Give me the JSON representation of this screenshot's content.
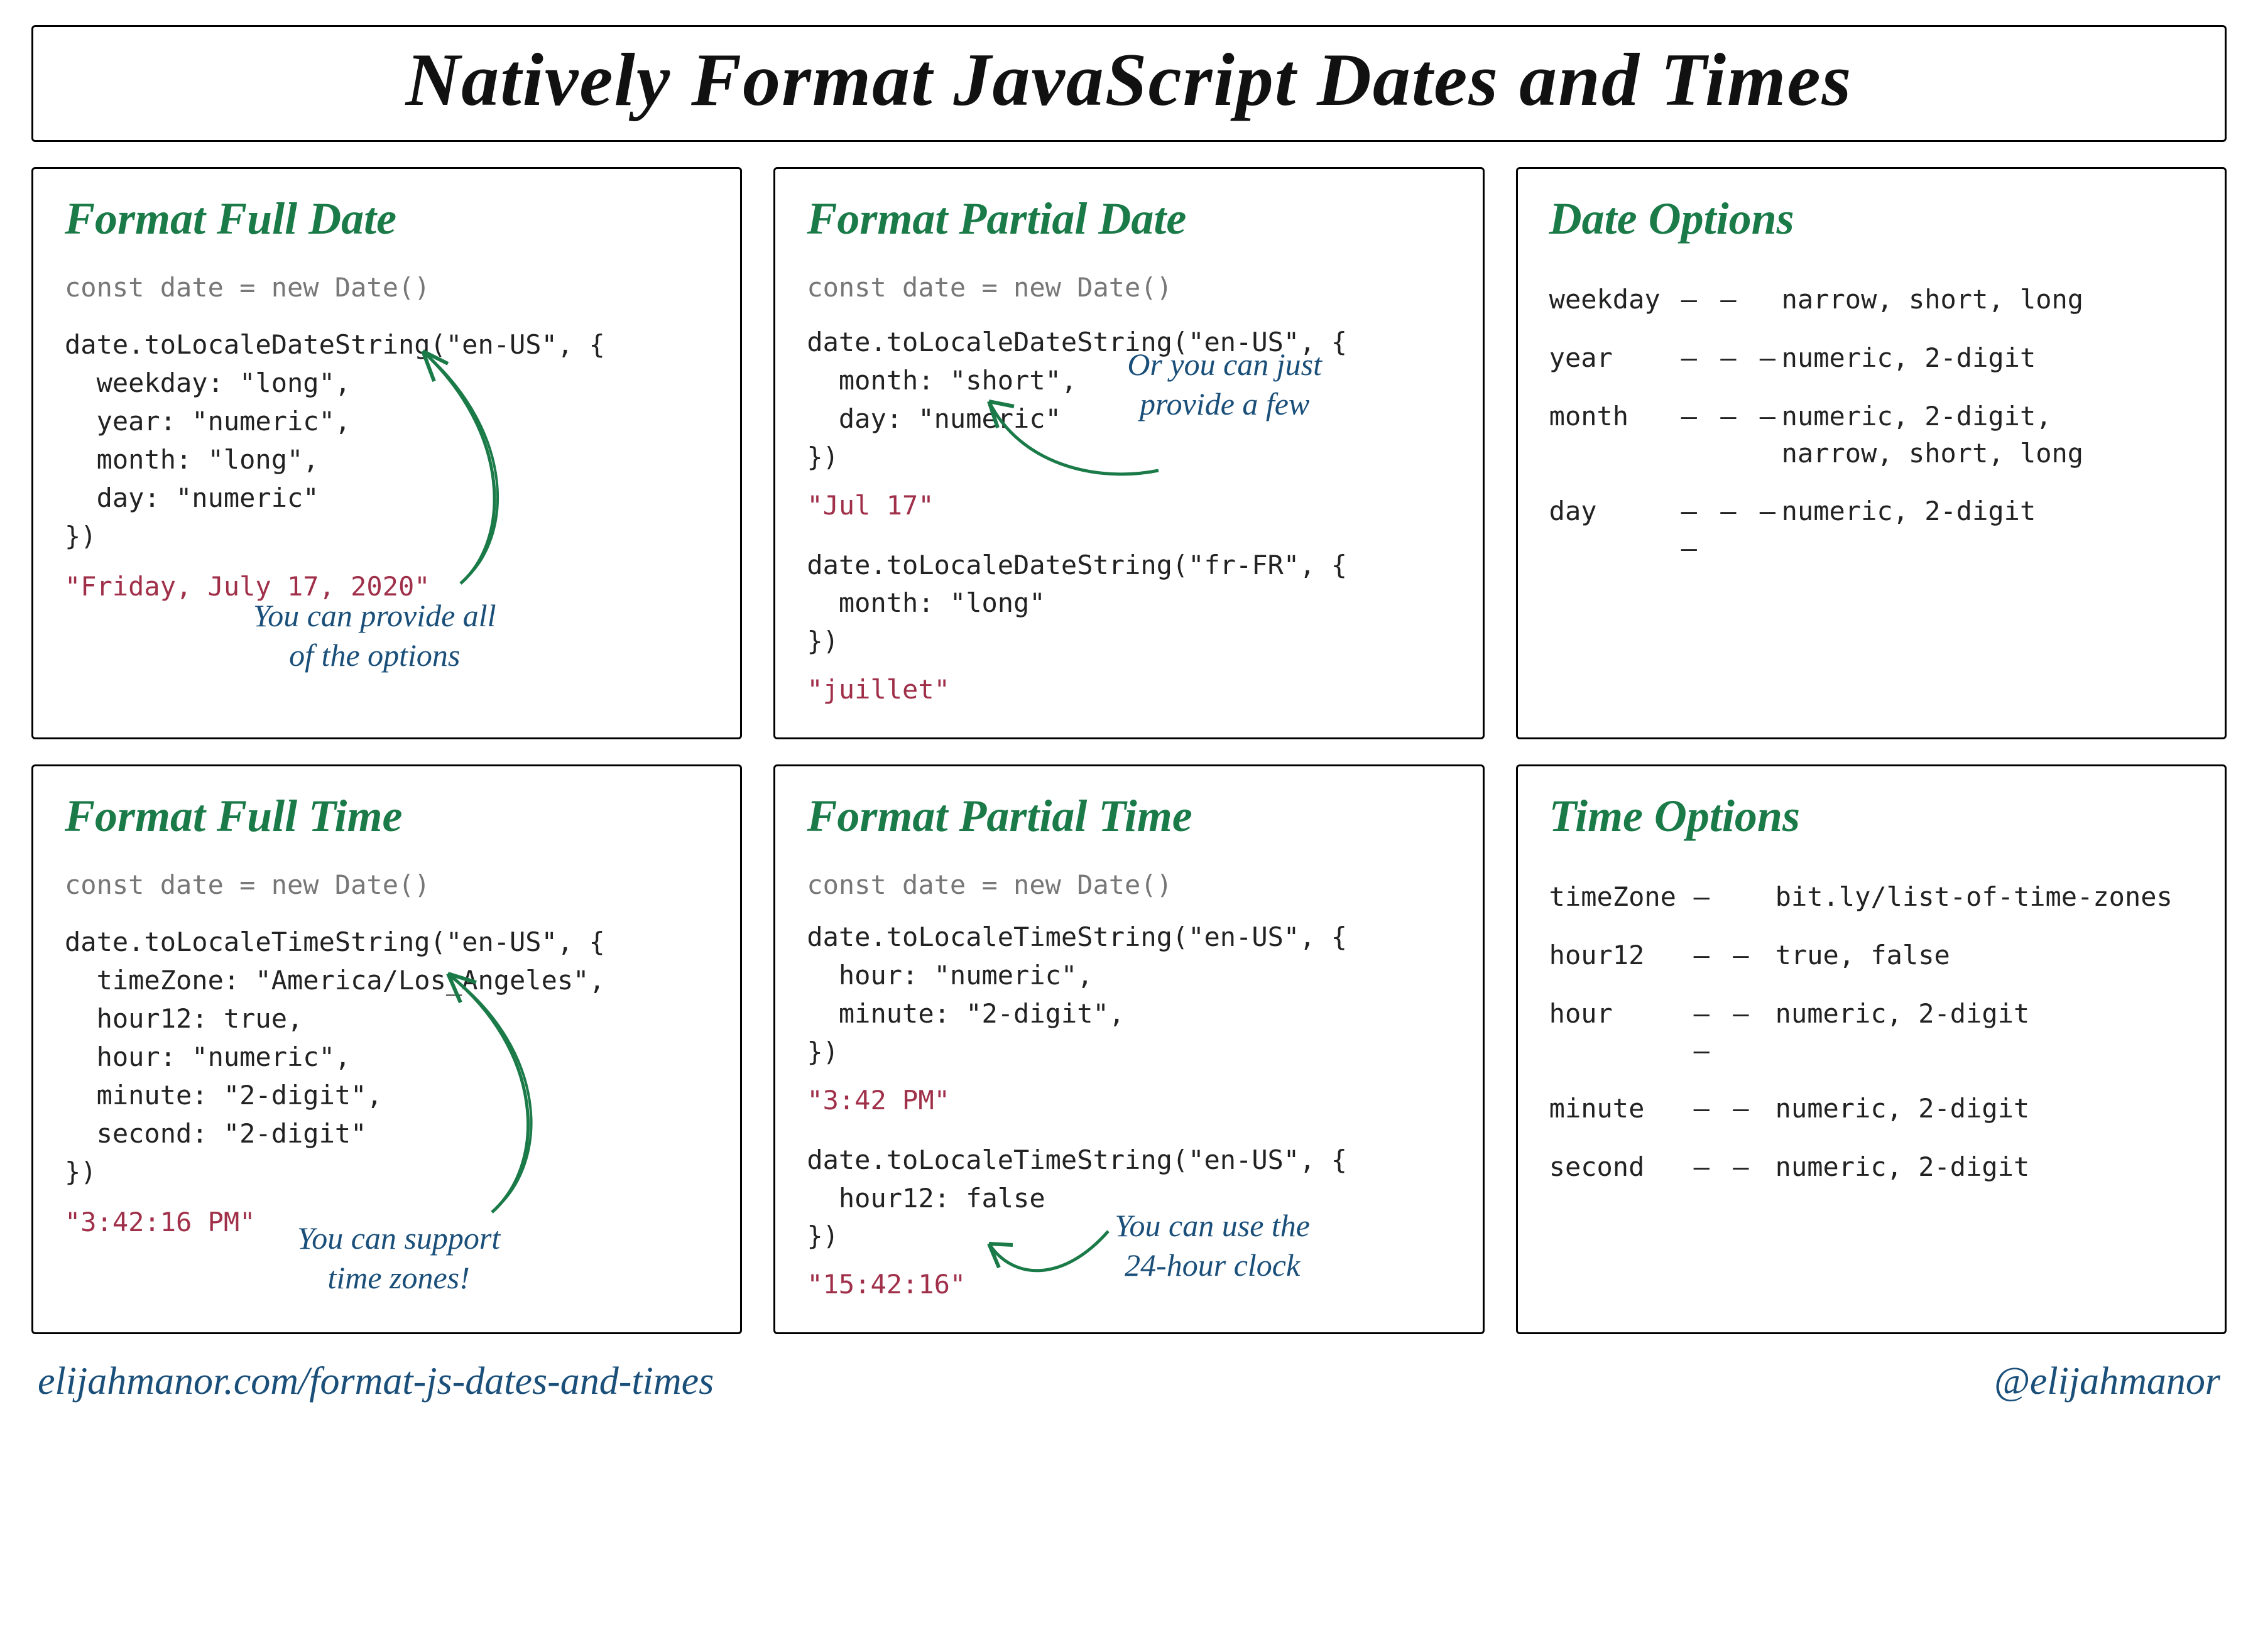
{
  "title": "Natively Format JavaScript Dates and Times",
  "cards": {
    "fullDate": {
      "title": "Format Full Date",
      "decl": "const date = new Date()",
      "code": "date.toLocaleDateString(\"en-US\", {\n  weekday: \"long\",\n  year: \"numeric\",\n  month: \"long\",\n  day: \"numeric\"\n})",
      "result": "\"Friday, July 17, 2020\"",
      "annotation": "You can provide all\nof the options"
    },
    "partialDate": {
      "title": "Format Partial Date",
      "decl": "const date = new Date()",
      "code1": "date.toLocaleDateString(\"en-US\", {\n  month: \"short\",\n  day: \"numeric\"\n})",
      "result1": "\"Jul 17\"",
      "code2": "date.toLocaleDateString(\"fr-FR\", {\n  month: \"long\"\n})",
      "result2": "\"juillet\"",
      "annotation": "Or you can just\nprovide a few"
    },
    "dateOptions": {
      "title": "Date Options",
      "rows": [
        {
          "key": "weekday",
          "dash": "— —",
          "vals": "narrow, short, long"
        },
        {
          "key": "year",
          "dash": "— — —",
          "vals": "numeric, 2-digit"
        },
        {
          "key": "month",
          "dash": "— — —",
          "vals": "numeric, 2-digit,\nnarrow, short, long"
        },
        {
          "key": "day",
          "dash": "— — — —",
          "vals": "numeric, 2-digit"
        }
      ]
    },
    "fullTime": {
      "title": "Format Full Time",
      "decl": "const date = new Date()",
      "code": "date.toLocaleTimeString(\"en-US\", {\n  timeZone: \"America/Los_Angeles\",\n  hour12: true,\n  hour: \"numeric\",\n  minute: \"2-digit\",\n  second: \"2-digit\"\n})",
      "result": "\"3:42:16 PM\"",
      "annotation": "You can support\ntime zones!"
    },
    "partialTime": {
      "title": "Format Partial Time",
      "decl": "const date = new Date()",
      "code1": "date.toLocaleTimeString(\"en-US\", {\n  hour: \"numeric\",\n  minute: \"2-digit\",\n})",
      "result1": "\"3:42 PM\"",
      "code2": "date.toLocaleTimeString(\"en-US\", {\n  hour12: false\n})",
      "result2": "\"15:42:16\"",
      "annotation": "You can use the\n24-hour clock"
    },
    "timeOptions": {
      "title": "Time Options",
      "rows": [
        {
          "key": "timeZone",
          "dash": "—",
          "vals": "bit.ly/list-of-time-zones"
        },
        {
          "key": "hour12",
          "dash": "— —",
          "vals": "true, false"
        },
        {
          "key": "hour",
          "dash": "— — —",
          "vals": "numeric, 2-digit"
        },
        {
          "key": "minute",
          "dash": "— —",
          "vals": "numeric, 2-digit"
        },
        {
          "key": "second",
          "dash": "— —",
          "vals": "numeric, 2-digit"
        }
      ]
    }
  },
  "footer": {
    "url": "elijahmanor.com/format-js-dates-and-times",
    "handle": "@elijahmanor"
  }
}
